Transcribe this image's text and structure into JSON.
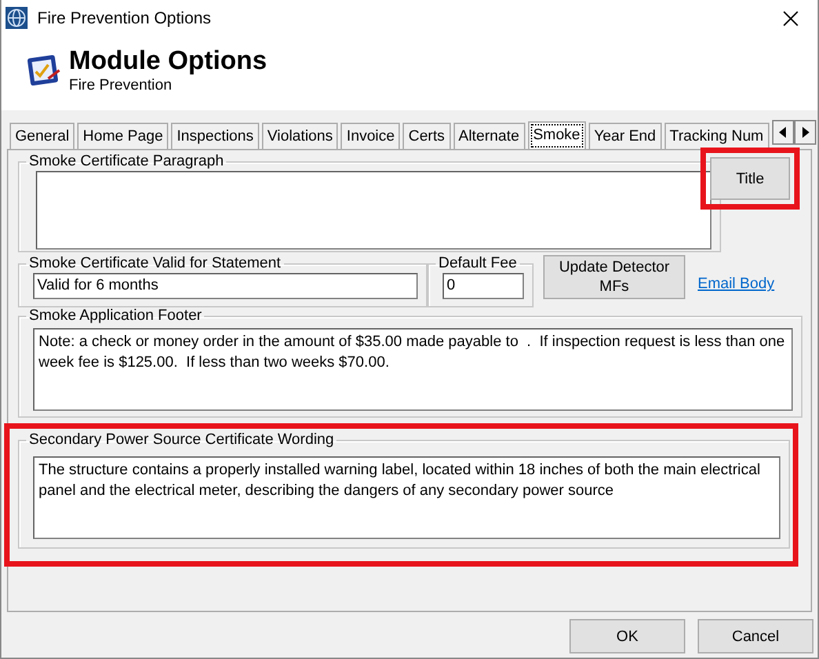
{
  "window": {
    "title": "Fire Prevention Options"
  },
  "header": {
    "title": "Module Options",
    "subtitle": "Fire Prevention"
  },
  "tabs": [
    {
      "label": "General",
      "selected": false
    },
    {
      "label": "Home Page",
      "selected": false
    },
    {
      "label": "Inspections",
      "selected": false
    },
    {
      "label": "Violations",
      "selected": false
    },
    {
      "label": "Invoice",
      "selected": false
    },
    {
      "label": "Certs",
      "selected": false
    },
    {
      "label": "Alternate",
      "selected": false
    },
    {
      "label": "Smoke",
      "selected": true
    },
    {
      "label": "Year End",
      "selected": false
    },
    {
      "label": "Tracking Num",
      "selected": false
    }
  ],
  "certificate_paragraph": {
    "label": "Smoke Certificate Paragraph"
  },
  "title_button": {
    "label": "Title",
    "highlighted": true
  },
  "valid_statement": {
    "label": "Smoke Certificate Valid for Statement",
    "value": "Valid for 6 months"
  },
  "default_fee": {
    "label": "Default Fee",
    "value": "0"
  },
  "update_button": {
    "label": "Update Detector MFs"
  },
  "email_link": {
    "label": "Email Body"
  },
  "footer": {
    "label": "Smoke Application Footer",
    "value": "Note: a check or money order in the amount of $35.00 made payable to  .  If inspection request is less than one week fee is $125.00.  If less than two weeks $70.00."
  },
  "secondary": {
    "label": "Secondary Power Source Certificate Wording",
    "value": "The structure contains a properly installed warning label, located within 18 inches of both the main electrical panel and the electrical meter, describing the dangers of any secondary power source",
    "highlighted": true
  },
  "buttons": [
    {
      "label": "OK"
    },
    {
      "label": "Cancel"
    }
  ]
}
